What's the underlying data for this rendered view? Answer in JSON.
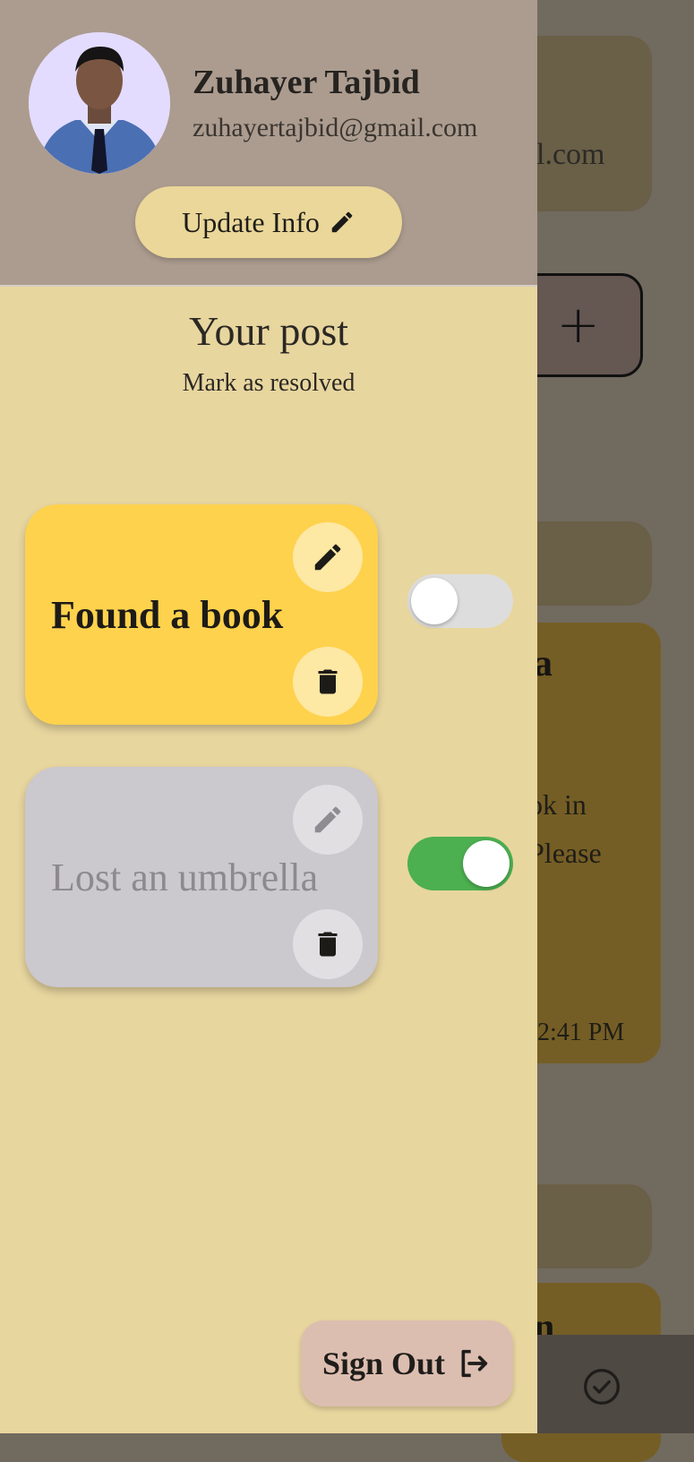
{
  "background": {
    "email_fragment": "l.com",
    "add_icon": "plus-icon",
    "post_title_fragment": "a",
    "post_line1_fragment": "ok in",
    "post_line2_fragment": "Please",
    "post_time_fragment": "2:41 PM",
    "post2_title_fragment": "n",
    "bottom_nav_icon": "check-circle-icon"
  },
  "profile": {
    "name": "Zuhayer Tajbid",
    "email": "zuhayertajbid@gmail.com",
    "update_label": "Update Info",
    "update_icon": "pencil-icon"
  },
  "section": {
    "title": "Your post",
    "subtitle": "Mark as resolved"
  },
  "posts": [
    {
      "title": "Found a book",
      "resolved": false,
      "color": "#fed24d"
    },
    {
      "title": "Lost an umbrella",
      "resolved": true,
      "color": "#cbc8ce"
    }
  ],
  "sign_out": {
    "label": "Sign Out",
    "icon": "sign-out-icon"
  },
  "colors": {
    "drawer": "#e8d69f",
    "header": "#ac9c8f",
    "toggle_on": "#4caf50",
    "toggle_off": "#dddddd"
  }
}
